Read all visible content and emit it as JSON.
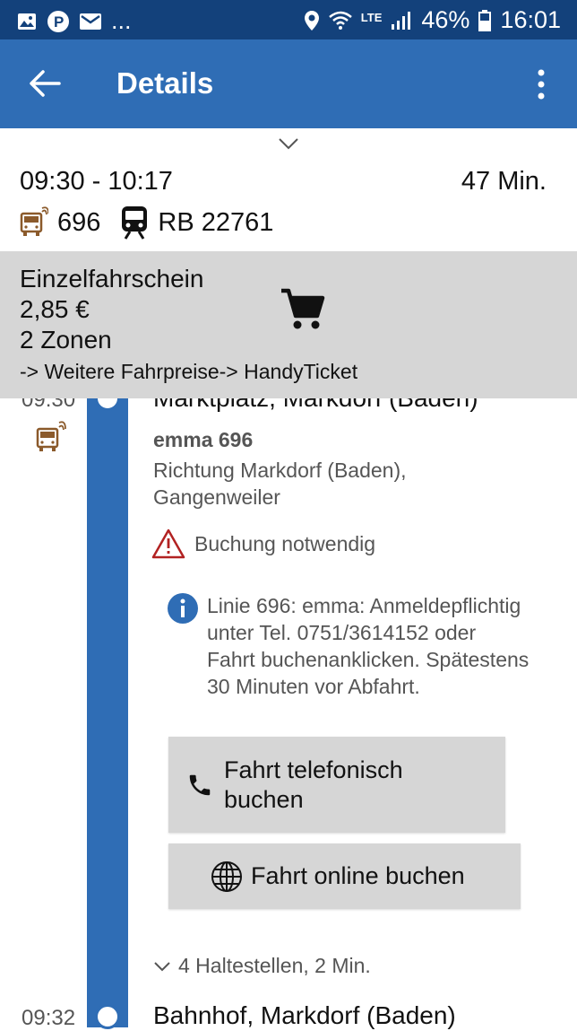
{
  "status_bar": {
    "time": "16:01",
    "battery": "46%",
    "network": "LTE",
    "notifications_more": "...",
    "icons": [
      "image-icon",
      "parking-icon",
      "mail-icon",
      "location-icon",
      "wifi-icon",
      "signal-icon",
      "battery-icon"
    ]
  },
  "app_bar": {
    "title": "Details",
    "colors": {
      "status_bar": "#13417b",
      "app_bar": "#2f6db5"
    }
  },
  "summary": {
    "time_range": "09:30 - 10:17",
    "duration": "47 Min.",
    "legs": [
      {
        "icon": "bus-icon",
        "label": "696"
      },
      {
        "icon": "train-icon",
        "label": "RB 22761"
      }
    ]
  },
  "fare": {
    "name": "Einzelfahrschein",
    "price": "2,85 €",
    "zones": "2 Zonen",
    "link_more": "-> Weitere Fahrpreise",
    "link_handy": "-> HandyTicket"
  },
  "itinerary": {
    "first_stop": {
      "time": "09:30",
      "name": "Marktplatz, Markdorf (Baden)"
    },
    "line_name": "emma 696",
    "direction": "Richtung Markdorf (Baden), Gangenweiler",
    "booking_notice": "Buchung notwendig",
    "info_text": "Linie 696: emma: Anmeldepflichtig unter Tel. 0751/3614152 oder Fahrt buchenanklicken. Spätestens 30 Minuten vor Abfahrt.",
    "button_phone": "Fahrt telefonisch buchen",
    "button_online": "Fahrt online buchen",
    "stops_summary": "4 Haltestellen, 2 Min.",
    "next_stop": {
      "time": "09:32",
      "name": "Bahnhof, Markdorf (Baden)"
    }
  }
}
